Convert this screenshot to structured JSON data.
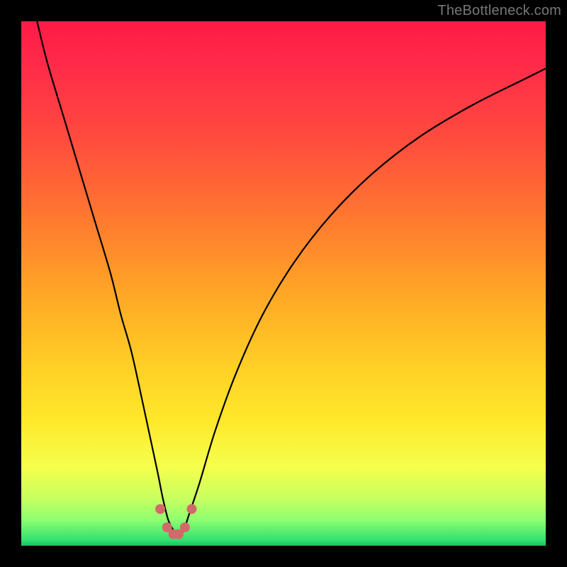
{
  "watermark": "TheBottleneck.com",
  "colors": {
    "frame": "#000000",
    "gradient_top": "#ff1a47",
    "gradient_mid": "#ffd026",
    "gradient_bottom": "#18c060",
    "curve": "#000000",
    "dots": "#d36a6a"
  },
  "chart_data": {
    "type": "line",
    "title": "",
    "xlabel": "",
    "ylabel": "",
    "xlim": [
      0,
      100
    ],
    "ylim": [
      0,
      100
    ],
    "series": [
      {
        "name": "bottleneck-curve",
        "x": [
          3,
          5,
          8,
          11,
          14,
          17,
          19,
          21,
          23,
          24.5,
          26,
          27,
          28,
          29,
          30,
          31,
          32,
          34,
          37,
          41,
          46,
          52,
          59,
          67,
          76,
          86,
          96,
          100
        ],
        "y": [
          100,
          92,
          82,
          72,
          62,
          52,
          44,
          37,
          28,
          21,
          14,
          9,
          5,
          3,
          2,
          3,
          6,
          12,
          22,
          33,
          44,
          54,
          63,
          71,
          78,
          84,
          89,
          91
        ]
      }
    ],
    "dots": [
      {
        "x": 26.5,
        "y": 7
      },
      {
        "x": 27.8,
        "y": 3.5
      },
      {
        "x": 29.0,
        "y": 2.2
      },
      {
        "x": 30.0,
        "y": 2.2
      },
      {
        "x": 31.2,
        "y": 3.5
      },
      {
        "x": 32.5,
        "y": 7
      }
    ]
  }
}
